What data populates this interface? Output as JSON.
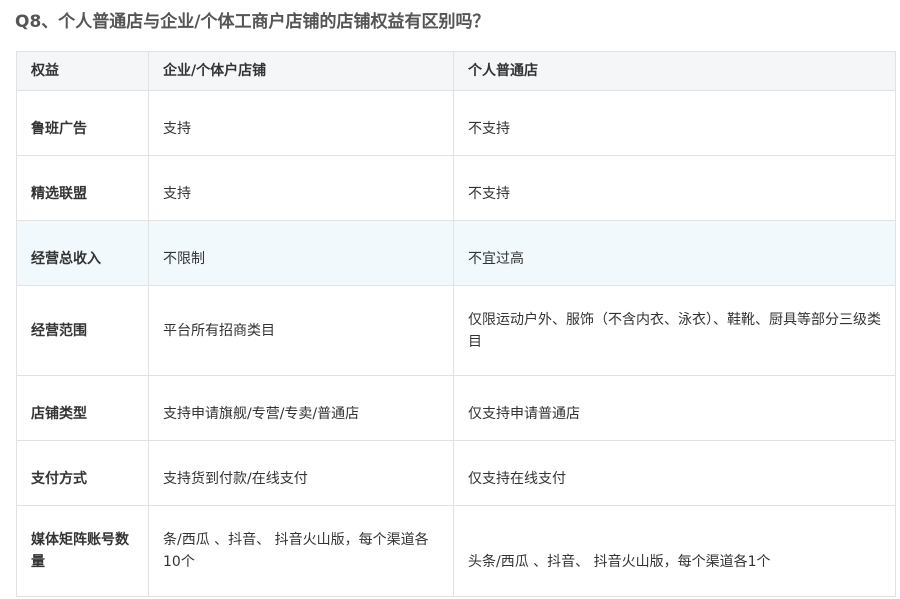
{
  "question": "Q8、个人普通店与企业/个体工商户店铺的店铺权益有区别吗？",
  "table": {
    "headers": [
      "权益",
      "企业/个体户店铺",
      "个人普通店"
    ],
    "rows": [
      {
        "name": "鲁班广告",
        "enterprise": "支持",
        "personal": "不支持"
      },
      {
        "name": "精选联盟",
        "enterprise": "支持",
        "personal": "不支持"
      },
      {
        "name": "经营总收入",
        "enterprise": "不限制",
        "personal": "不宜过高"
      },
      {
        "name": "经营范围",
        "enterprise": "平台所有招商类目",
        "personal": "仅限运动户外、服饰（不含内衣、泳衣）、鞋靴、厨具等部分三级类目"
      },
      {
        "name": "店铺类型",
        "enterprise": "支持申请旗舰/专营/专卖/普通店",
        "personal": "仅支持申请普通店"
      },
      {
        "name": "支付方式",
        "enterprise": "支持货到付款/在线支付",
        "personal": "仅支持在线支付"
      },
      {
        "name": "媒体矩阵账号数量",
        "enterprise": "条/西瓜 、抖音、 抖音火山版，每个渠道各10个",
        "personal": "头条/西瓜 、抖音、 抖音火山版，每个渠道各1个"
      }
    ]
  },
  "colors": {
    "header_bg": "#f5f6f8",
    "highlight_row_bg": "#f1f9fd",
    "border": "#e2e2e2",
    "text": "#333333",
    "title": "#555555"
  }
}
